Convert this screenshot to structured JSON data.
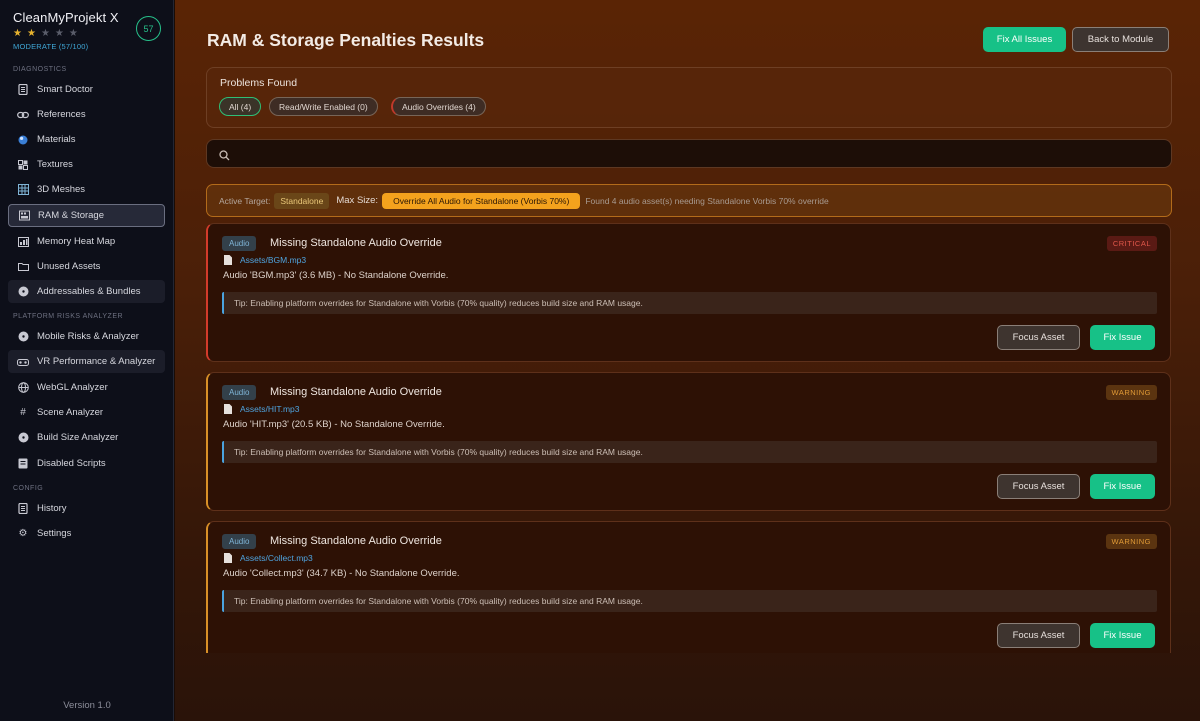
{
  "app": {
    "title": "CleanMyProjekt X",
    "rating_stars": 2,
    "rating_max": 5,
    "status": "MODERATE (57/100)",
    "score": "57",
    "version": "Version 1.0"
  },
  "sidebar": {
    "sections": [
      {
        "label": "DIAGNOSTICS"
      },
      {
        "label": "PLATFORM RISKS ANALYZER"
      },
      {
        "label": "CONFIG"
      }
    ],
    "items": [
      {
        "label": "Smart Doctor",
        "icon": "doc-icon"
      },
      {
        "label": "References",
        "icon": "link-icon"
      },
      {
        "label": "Materials",
        "icon": "sphere-icon"
      },
      {
        "label": "Textures",
        "icon": "texture-icon"
      },
      {
        "label": "3D Meshes",
        "icon": "grid-icon"
      },
      {
        "label": "RAM & Storage",
        "icon": "storage-icon"
      },
      {
        "label": "Memory Heat Map",
        "icon": "heatmap-icon"
      },
      {
        "label": "Unused Assets",
        "icon": "folder-icon"
      },
      {
        "label": "Addressables & Bundles",
        "icon": "bundle-icon"
      },
      {
        "label": "Mobile Risks & Analyzer",
        "icon": "bundle-icon"
      },
      {
        "label": "VR Performance & Analyzer",
        "icon": "vr-icon"
      },
      {
        "label": "WebGL Analyzer",
        "icon": "globe-icon"
      },
      {
        "label": "Scene Analyzer",
        "icon": "hash-icon"
      },
      {
        "label": "Build Size Analyzer",
        "icon": "bundle-icon"
      },
      {
        "label": "Disabled Scripts",
        "icon": "script-icon"
      },
      {
        "label": "History",
        "icon": "doc-icon"
      },
      {
        "label": "Settings",
        "icon": "gear-icon"
      }
    ]
  },
  "header": {
    "title": "RAM & Storage Penalties Results",
    "fix_all_label": "Fix All Issues",
    "back_label": "Back to Module"
  },
  "problems": {
    "title": "Problems Found",
    "filters": [
      {
        "label": "All (4)"
      },
      {
        "label": "Read/Write Enabled (0)"
      },
      {
        "label": "Audio Overrides (4)"
      }
    ]
  },
  "search": {
    "placeholder": ""
  },
  "target": {
    "active_label": "Active Target:",
    "active_value": "Standalone",
    "size_label": "Max Size:",
    "size_value": "Override All Audio for Standalone (Vorbis 70%)",
    "found_text": "Found 4 audio asset(s) needing Standalone Vorbis 70% override"
  },
  "issues": [
    {
      "type": "Audio",
      "title": "Missing Standalone Audio Override",
      "severity": "CRITICAL",
      "path": "Assets/BGM.mp3",
      "desc": "Audio 'BGM.mp3' (3.6 MB) - No Standalone Override.",
      "tip": "Tip: Enabling platform overrides for Standalone with Vorbis (70% quality) reduces build size and RAM usage.",
      "focus_label": "Focus Asset",
      "fix_label": "Fix Issue"
    },
    {
      "type": "Audio",
      "title": "Missing Standalone Audio Override",
      "severity": "WARNING",
      "path": "Assets/HIT.mp3",
      "desc": "Audio 'HIT.mp3' (20.5 KB) - No Standalone Override.",
      "tip": "Tip: Enabling platform overrides for Standalone with Vorbis (70% quality) reduces build size and RAM usage.",
      "focus_label": "Focus Asset",
      "fix_label": "Fix Issue"
    },
    {
      "type": "Audio",
      "title": "Missing Standalone Audio Override",
      "severity": "WARNING",
      "path": "Assets/Collect.mp3",
      "desc": "Audio 'Collect.mp3' (34.7 KB) - No Standalone Override.",
      "tip": "Tip: Enabling platform overrides for Standalone with Vorbis (70% quality) reduces build size and RAM usage.",
      "focus_label": "Focus Asset",
      "fix_label": "Fix Issue"
    }
  ],
  "colors": {
    "accent_green": "#17c187",
    "critical": "#d33b2b",
    "warning": "#d99027",
    "link": "#4fa4df",
    "highlight": "#f4a21d"
  }
}
